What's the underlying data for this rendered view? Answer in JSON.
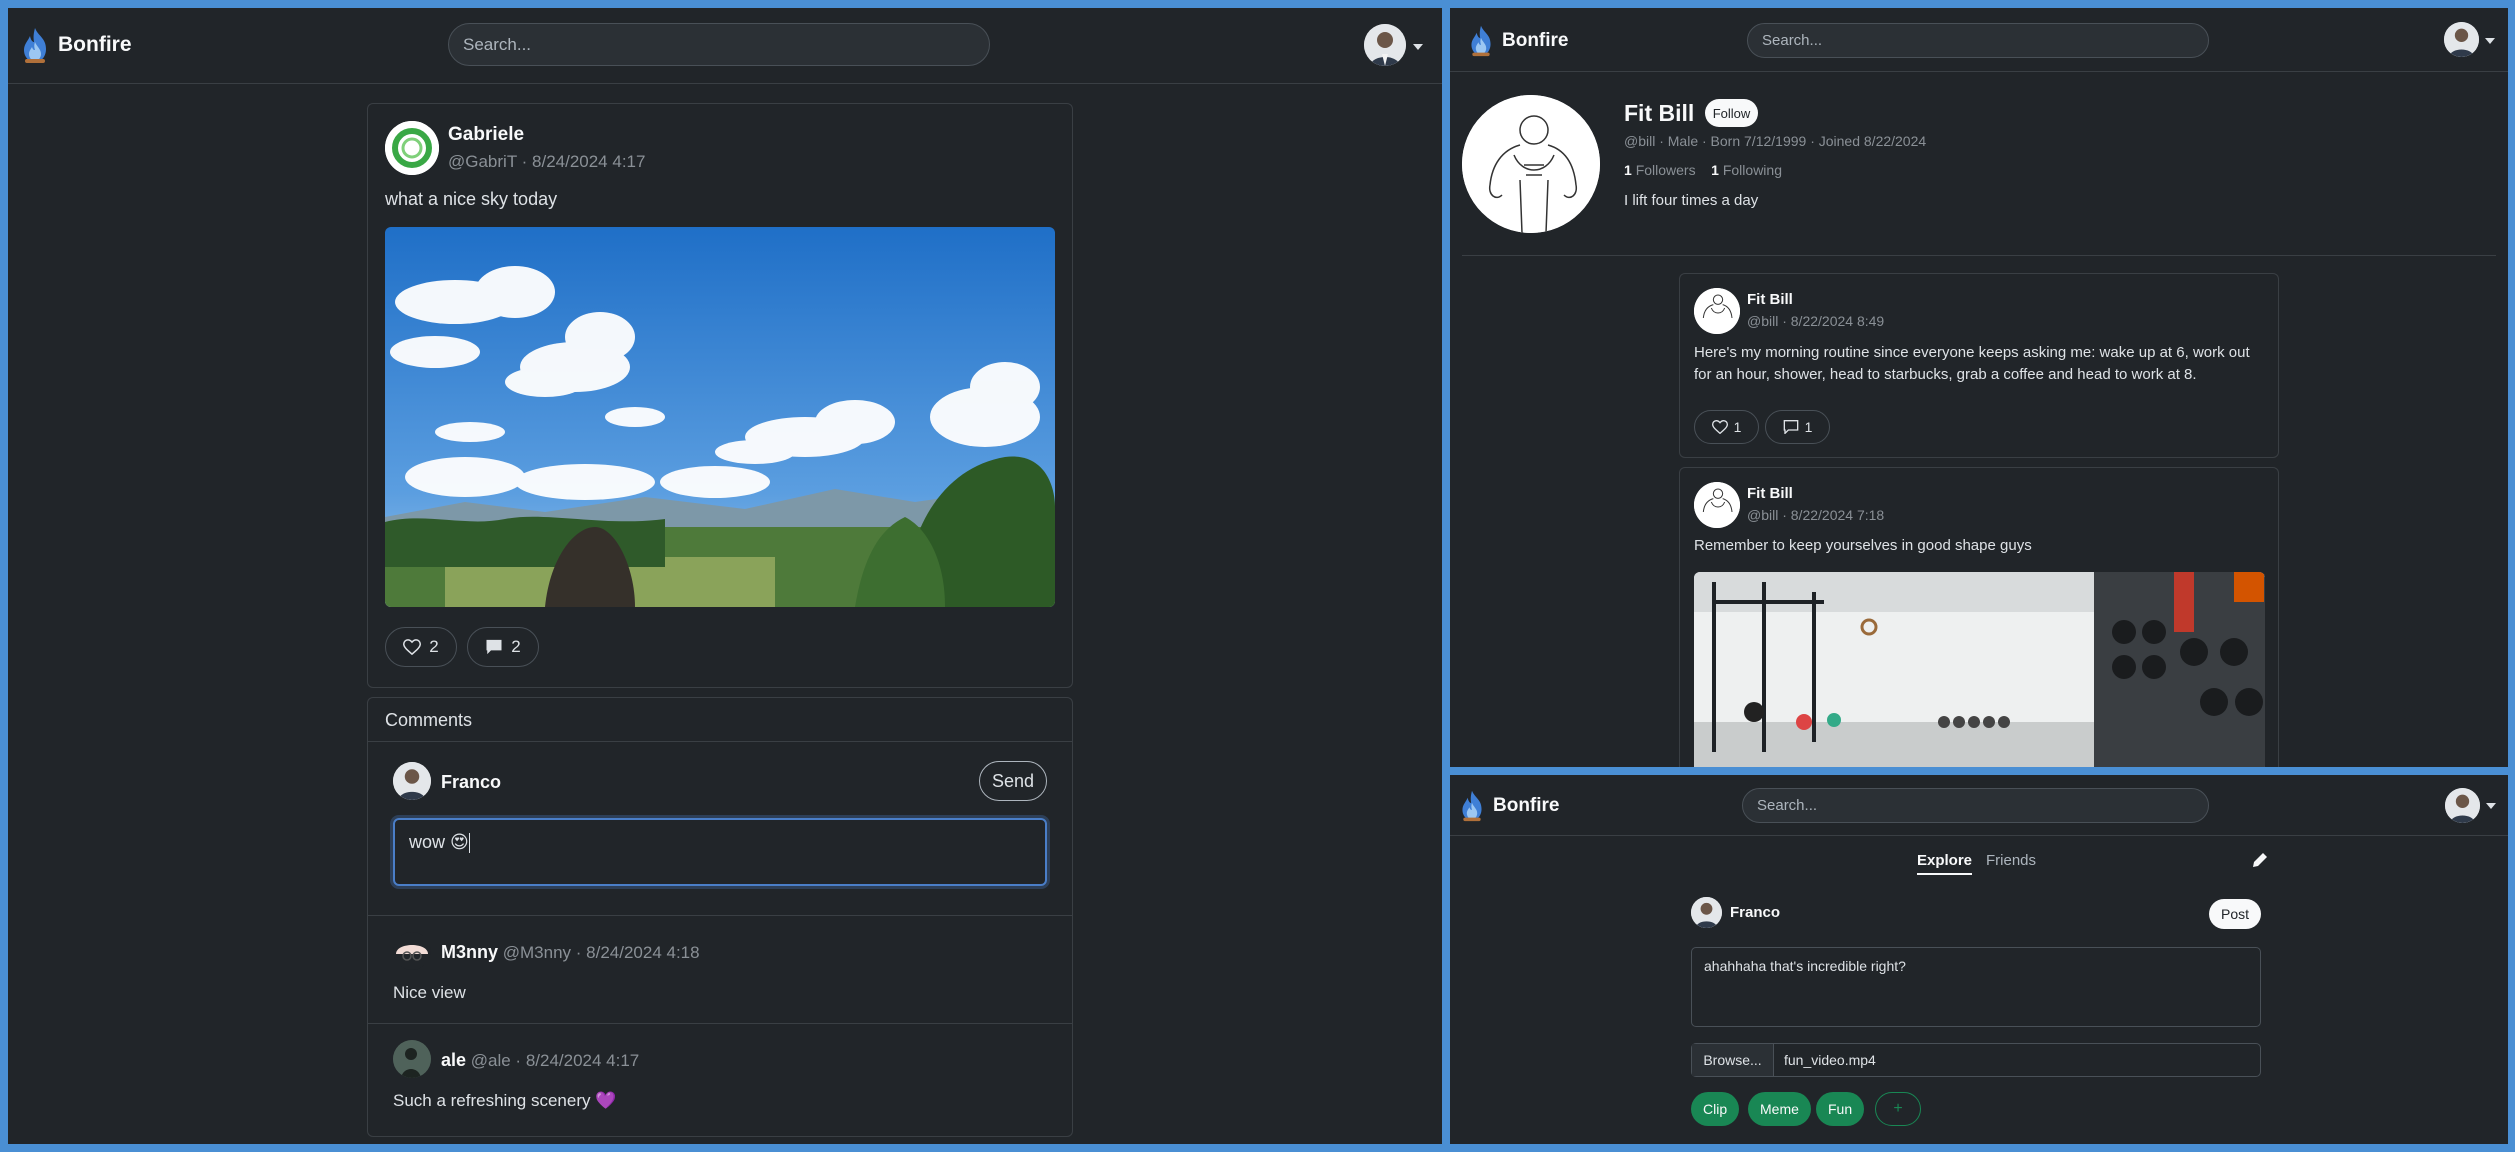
{
  "colors": {
    "background": "#212529",
    "frame": "#4a8fd4",
    "border": "#3a3f44",
    "focus": "#4a7ec8",
    "tag_green": "#198754"
  },
  "app": {
    "brand": "Bonfire",
    "search_placeholder": "Search..."
  },
  "post_view": {
    "post": {
      "author": "Gabriele",
      "meta": "@GabriT · 8/24/2024 4:17",
      "text": "what a nice sky today",
      "likes": "2",
      "comments": "2"
    },
    "comments_header": "Comments",
    "composer": {
      "user": "Franco",
      "send_label": "Send",
      "value": "wow 😍"
    },
    "comments": [
      {
        "name": "M3nny",
        "meta": "@M3nny · 8/24/2024 4:18",
        "text": "Nice view"
      },
      {
        "name": "ale",
        "meta": "@ale · 8/24/2024 4:17",
        "text": "Such a refreshing scenery 💜"
      }
    ]
  },
  "profile": {
    "name": "Fit Bill",
    "follow_label": "Follow",
    "meta": "@bill · Male · Born 7/12/1999 · Joined 8/22/2024",
    "followers_count": "1",
    "followers_label": "Followers",
    "following_count": "1",
    "following_label": "Following",
    "bio": "I lift four times a day",
    "posts": [
      {
        "author": "Fit Bill",
        "meta": "@bill · 8/22/2024 8:49",
        "text": "Here's my morning routine since everyone keeps asking me: wake up at 6, work out for an hour, shower, head to starbucks, grab a coffee and head to work at 8.",
        "likes": "1",
        "comments": "1"
      },
      {
        "author": "Fit Bill",
        "meta": "@bill · 8/22/2024 7:18",
        "text": "Remember to keep yourselves in good shape guys"
      }
    ]
  },
  "feed": {
    "tabs": [
      "Explore",
      "Friends"
    ],
    "composer": {
      "user": "Franco",
      "post_label": "Post",
      "text": "ahahhaha that's incredible right?",
      "browse_label": "Browse...",
      "file_name": "fun_video.mp4"
    },
    "tags": [
      "Clip",
      "Meme",
      "Fun"
    ],
    "add_tag": "+"
  }
}
